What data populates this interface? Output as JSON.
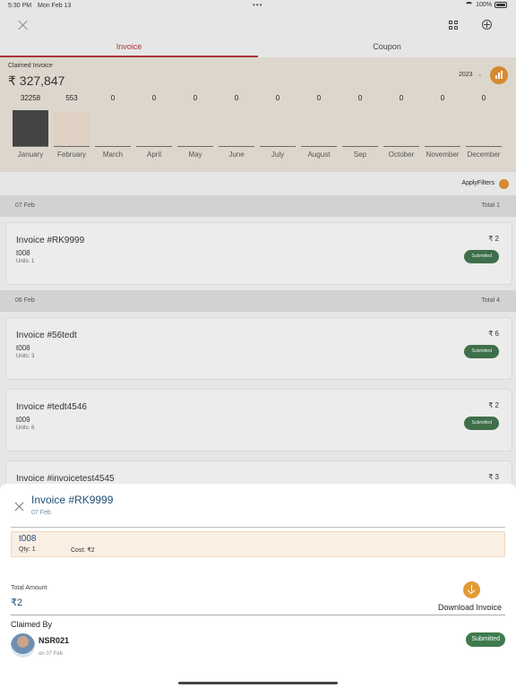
{
  "status": {
    "time": "5:30 PM",
    "date": "Mon Feb 13",
    "dots": "•••",
    "battery": "100%"
  },
  "tabs": [
    {
      "label": "Invoice",
      "active": true
    },
    {
      "label": "Coupon",
      "active": false
    }
  ],
  "summary": {
    "label": "Claimed Invoice",
    "total": "₹ 327,847",
    "year": "2023"
  },
  "chart_data": {
    "type": "bar",
    "categories": [
      "January",
      "February",
      "March",
      "April",
      "May",
      "June",
      "July",
      "August",
      "Sep",
      "October",
      "November",
      "December"
    ],
    "values": [
      32258,
      553,
      0,
      0,
      0,
      0,
      0,
      0,
      0,
      0,
      0,
      0
    ],
    "value_labels": [
      "32258",
      "553",
      "0",
      "0",
      "0",
      "0",
      "0",
      "0",
      "0",
      "0",
      "0",
      "0"
    ]
  },
  "filters": {
    "label": "ApplyFilters"
  },
  "groups": [
    {
      "date": "07 Feb",
      "total": "Total 1",
      "invoices": [
        {
          "title": "Invoice #RK9999",
          "amount": "₹ 2",
          "code": "t008",
          "units": "Units:   1",
          "status": "Submitted"
        }
      ]
    },
    {
      "date": "06 Feb",
      "total": "Total 4",
      "invoices": [
        {
          "title": "Invoice #56tedt",
          "amount": "₹ 6",
          "code": "t008",
          "units": "Units:   3",
          "status": "Submitted"
        },
        {
          "title": "Invoice #tedt4546",
          "amount": "₹ 2",
          "code": "t009",
          "units": "Units:   6",
          "status": "Submitted"
        },
        {
          "title": "Invoice #invoicetest4545",
          "amount": "₹ 3",
          "code": "",
          "units": "",
          "status": ""
        }
      ]
    }
  ],
  "sheet": {
    "title": "Invoice #RK9999",
    "date": "07 Feb",
    "item": {
      "code": "t008",
      "qty": "Qty:  1",
      "cost": "Cost:  ₹2"
    },
    "total_label": "Total Amount",
    "total_value": "₹2",
    "download_label": "Download Invoice",
    "claimed_by_label": "Claimed By",
    "user": {
      "name": "NSR021",
      "date": "on 07 Feb"
    },
    "status": "Submitted"
  }
}
